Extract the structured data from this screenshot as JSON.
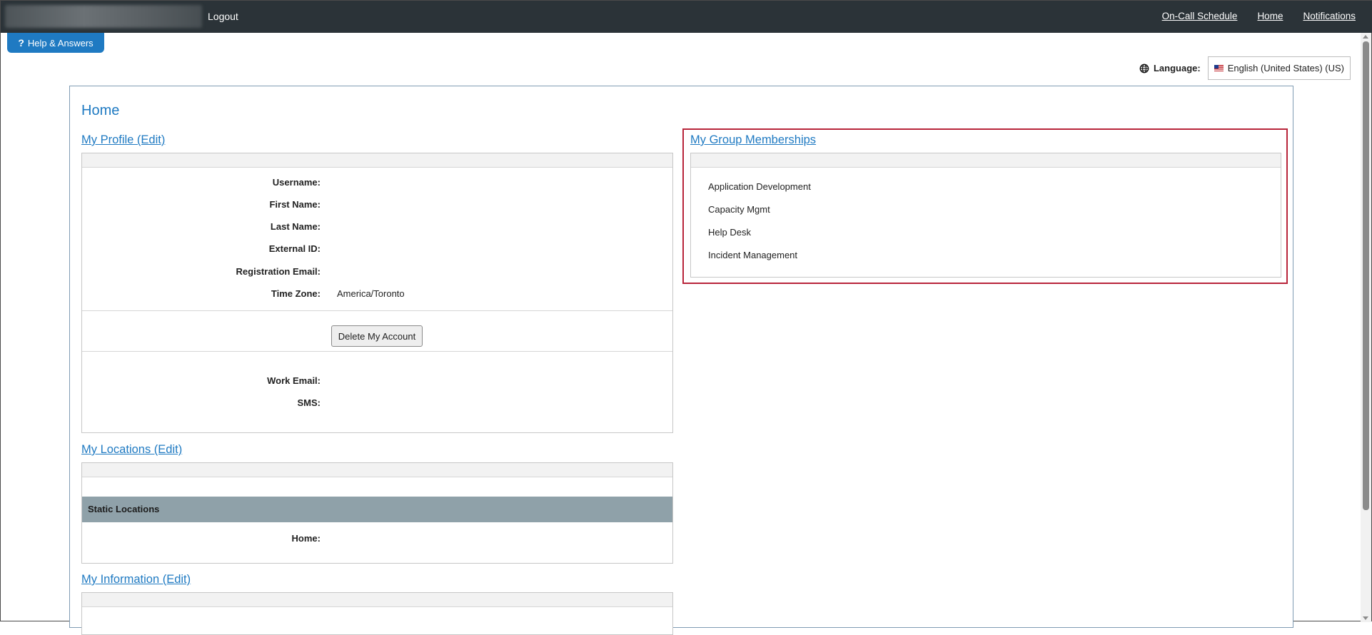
{
  "topbar": {
    "logout_label": "Logout",
    "nav": [
      {
        "label": "On-Call Schedule"
      },
      {
        "label": "Home"
      },
      {
        "label": "Notifications"
      }
    ]
  },
  "help": {
    "icon": "?",
    "label": "Help & Answers"
  },
  "language": {
    "label": "Language:",
    "selected": "English (United States) (US)",
    "icon": "globe-icon",
    "flag": "us-flag-icon"
  },
  "page": {
    "title": "Home"
  },
  "profile": {
    "title": "My Profile (Edit)",
    "fields": [
      {
        "label": "Username:",
        "value": ""
      },
      {
        "label": "First Name:",
        "value": ""
      },
      {
        "label": "Last Name:",
        "value": ""
      },
      {
        "label": "External ID:",
        "value": ""
      },
      {
        "label": "Registration Email:",
        "value": ""
      },
      {
        "label": "Time Zone:",
        "value": "America/Toronto"
      }
    ],
    "delete_button": "Delete My Account",
    "contact_fields": [
      {
        "label": "Work Email:",
        "value": ""
      },
      {
        "label": "SMS:",
        "value": ""
      }
    ]
  },
  "locations": {
    "title": "My Locations (Edit)",
    "static_header": "Static Locations",
    "fields": [
      {
        "label": "Home:",
        "value": ""
      }
    ]
  },
  "information": {
    "title": "My Information (Edit)"
  },
  "groups": {
    "title": "My Group Memberships",
    "items": [
      "Application Development",
      "Capacity Mgmt",
      "Help Desk",
      "Incident Management"
    ]
  },
  "colors": {
    "topbar": "#2b3338",
    "accent": "#1f7ac2",
    "highlight": "#b8253a",
    "static_bar": "#8fa1a9"
  }
}
